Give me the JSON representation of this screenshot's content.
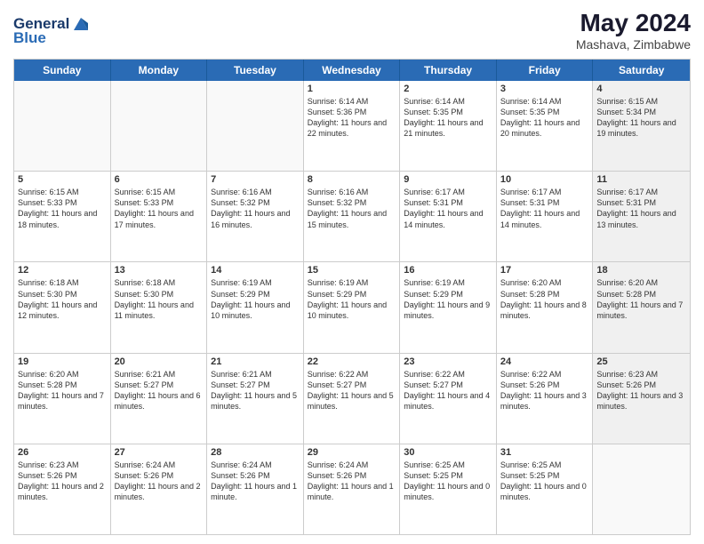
{
  "header": {
    "logo_general": "General",
    "logo_blue": "Blue",
    "month_year": "May 2024",
    "location": "Mashava, Zimbabwe"
  },
  "days": [
    "Sunday",
    "Monday",
    "Tuesday",
    "Wednesday",
    "Thursday",
    "Friday",
    "Saturday"
  ],
  "rows": [
    [
      {
        "day": "",
        "info": "",
        "empty": true
      },
      {
        "day": "",
        "info": "",
        "empty": true
      },
      {
        "day": "",
        "info": "",
        "empty": true
      },
      {
        "day": "1",
        "info": "Sunrise: 6:14 AM\nSunset: 5:36 PM\nDaylight: 11 hours and 22 minutes."
      },
      {
        "day": "2",
        "info": "Sunrise: 6:14 AM\nSunset: 5:35 PM\nDaylight: 11 hours and 21 minutes."
      },
      {
        "day": "3",
        "info": "Sunrise: 6:14 AM\nSunset: 5:35 PM\nDaylight: 11 hours and 20 minutes."
      },
      {
        "day": "4",
        "info": "Sunrise: 6:15 AM\nSunset: 5:34 PM\nDaylight: 11 hours and 19 minutes.",
        "shaded": true
      }
    ],
    [
      {
        "day": "5",
        "info": "Sunrise: 6:15 AM\nSunset: 5:33 PM\nDaylight: 11 hours and 18 minutes."
      },
      {
        "day": "6",
        "info": "Sunrise: 6:15 AM\nSunset: 5:33 PM\nDaylight: 11 hours and 17 minutes."
      },
      {
        "day": "7",
        "info": "Sunrise: 6:16 AM\nSunset: 5:32 PM\nDaylight: 11 hours and 16 minutes."
      },
      {
        "day": "8",
        "info": "Sunrise: 6:16 AM\nSunset: 5:32 PM\nDaylight: 11 hours and 15 minutes."
      },
      {
        "day": "9",
        "info": "Sunrise: 6:17 AM\nSunset: 5:31 PM\nDaylight: 11 hours and 14 minutes."
      },
      {
        "day": "10",
        "info": "Sunrise: 6:17 AM\nSunset: 5:31 PM\nDaylight: 11 hours and 14 minutes."
      },
      {
        "day": "11",
        "info": "Sunrise: 6:17 AM\nSunset: 5:31 PM\nDaylight: 11 hours and 13 minutes.",
        "shaded": true
      }
    ],
    [
      {
        "day": "12",
        "info": "Sunrise: 6:18 AM\nSunset: 5:30 PM\nDaylight: 11 hours and 12 minutes."
      },
      {
        "day": "13",
        "info": "Sunrise: 6:18 AM\nSunset: 5:30 PM\nDaylight: 11 hours and 11 minutes."
      },
      {
        "day": "14",
        "info": "Sunrise: 6:19 AM\nSunset: 5:29 PM\nDaylight: 11 hours and 10 minutes."
      },
      {
        "day": "15",
        "info": "Sunrise: 6:19 AM\nSunset: 5:29 PM\nDaylight: 11 hours and 10 minutes."
      },
      {
        "day": "16",
        "info": "Sunrise: 6:19 AM\nSunset: 5:29 PM\nDaylight: 11 hours and 9 minutes."
      },
      {
        "day": "17",
        "info": "Sunrise: 6:20 AM\nSunset: 5:28 PM\nDaylight: 11 hours and 8 minutes."
      },
      {
        "day": "18",
        "info": "Sunrise: 6:20 AM\nSunset: 5:28 PM\nDaylight: 11 hours and 7 minutes.",
        "shaded": true
      }
    ],
    [
      {
        "day": "19",
        "info": "Sunrise: 6:20 AM\nSunset: 5:28 PM\nDaylight: 11 hours and 7 minutes."
      },
      {
        "day": "20",
        "info": "Sunrise: 6:21 AM\nSunset: 5:27 PM\nDaylight: 11 hours and 6 minutes."
      },
      {
        "day": "21",
        "info": "Sunrise: 6:21 AM\nSunset: 5:27 PM\nDaylight: 11 hours and 5 minutes."
      },
      {
        "day": "22",
        "info": "Sunrise: 6:22 AM\nSunset: 5:27 PM\nDaylight: 11 hours and 5 minutes."
      },
      {
        "day": "23",
        "info": "Sunrise: 6:22 AM\nSunset: 5:27 PM\nDaylight: 11 hours and 4 minutes."
      },
      {
        "day": "24",
        "info": "Sunrise: 6:22 AM\nSunset: 5:26 PM\nDaylight: 11 hours and 3 minutes."
      },
      {
        "day": "25",
        "info": "Sunrise: 6:23 AM\nSunset: 5:26 PM\nDaylight: 11 hours and 3 minutes.",
        "shaded": true
      }
    ],
    [
      {
        "day": "26",
        "info": "Sunrise: 6:23 AM\nSunset: 5:26 PM\nDaylight: 11 hours and 2 minutes."
      },
      {
        "day": "27",
        "info": "Sunrise: 6:24 AM\nSunset: 5:26 PM\nDaylight: 11 hours and 2 minutes."
      },
      {
        "day": "28",
        "info": "Sunrise: 6:24 AM\nSunset: 5:26 PM\nDaylight: 11 hours and 1 minute."
      },
      {
        "day": "29",
        "info": "Sunrise: 6:24 AM\nSunset: 5:26 PM\nDaylight: 11 hours and 1 minute."
      },
      {
        "day": "30",
        "info": "Sunrise: 6:25 AM\nSunset: 5:25 PM\nDaylight: 11 hours and 0 minutes."
      },
      {
        "day": "31",
        "info": "Sunrise: 6:25 AM\nSunset: 5:25 PM\nDaylight: 11 hours and 0 minutes."
      },
      {
        "day": "",
        "info": "",
        "empty": true,
        "shaded": true
      }
    ]
  ]
}
